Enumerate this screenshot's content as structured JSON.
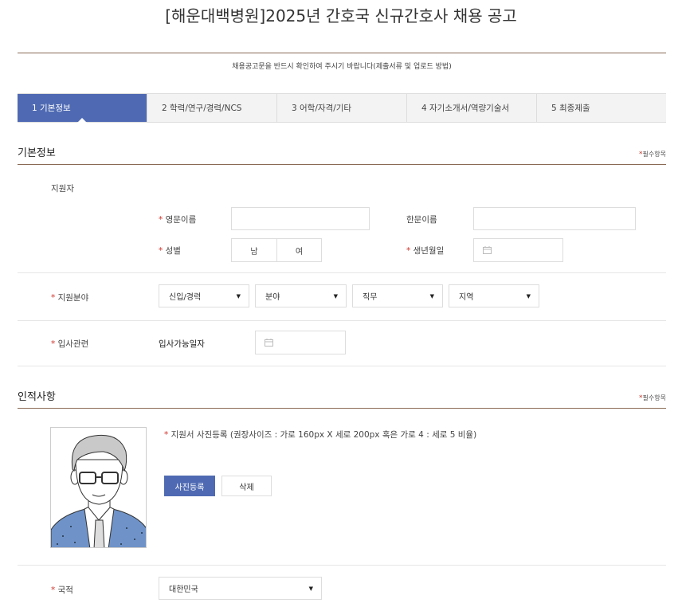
{
  "page": {
    "title": "[해운대백병원]2025년 간호국 신규간호사 채용 공고",
    "notice": "채용공고문을 반드시 확인하여 주시기 바랍니다(제출서류 및 업로드 방법)"
  },
  "tabs": [
    {
      "label": "1  기본정보",
      "active": true
    },
    {
      "label": "2  학력/연구/경력/NCS",
      "active": false
    },
    {
      "label": "3  어학/자격/기타",
      "active": false
    },
    {
      "label": "4  자기소개서/역량기술서",
      "active": false
    },
    {
      "label": "5  최종제출",
      "active": false
    }
  ],
  "required_mark": "*",
  "required_text": "필수항목",
  "basic": {
    "section_title": "기본정보",
    "applicant_label": "지원자",
    "english_name_label": "영문이름",
    "english_name_value": "",
    "chinese_name_label": "한문이름",
    "chinese_name_value": "",
    "gender_label": "성별",
    "gender_male": "남",
    "gender_female": "여",
    "birth_label": "생년월일",
    "birth_value": "",
    "field_label": "지원분야",
    "field_selects": [
      "신입/경력",
      "분야",
      "직무",
      "지역"
    ],
    "join_label": "입사관련",
    "available_date_label": "입사가능일자",
    "available_date_value": ""
  },
  "personal": {
    "section_title": "인적사항",
    "photo_guide": "지원서 사진등록 (권장사이즈 : 가로 160px X 세로 200px 혹은 가로 4 : 세로 5 비율)",
    "upload_button": "사진등록",
    "delete_button": "삭제",
    "nationality_label": "국적",
    "nationality_value": "대한민국"
  },
  "colors": {
    "accent": "#4f6ab3",
    "rule": "#8a6a55",
    "required": "#d0342c"
  },
  "icons": [
    "calendar-icon",
    "caret-down-icon",
    "avatar-placeholder"
  ]
}
